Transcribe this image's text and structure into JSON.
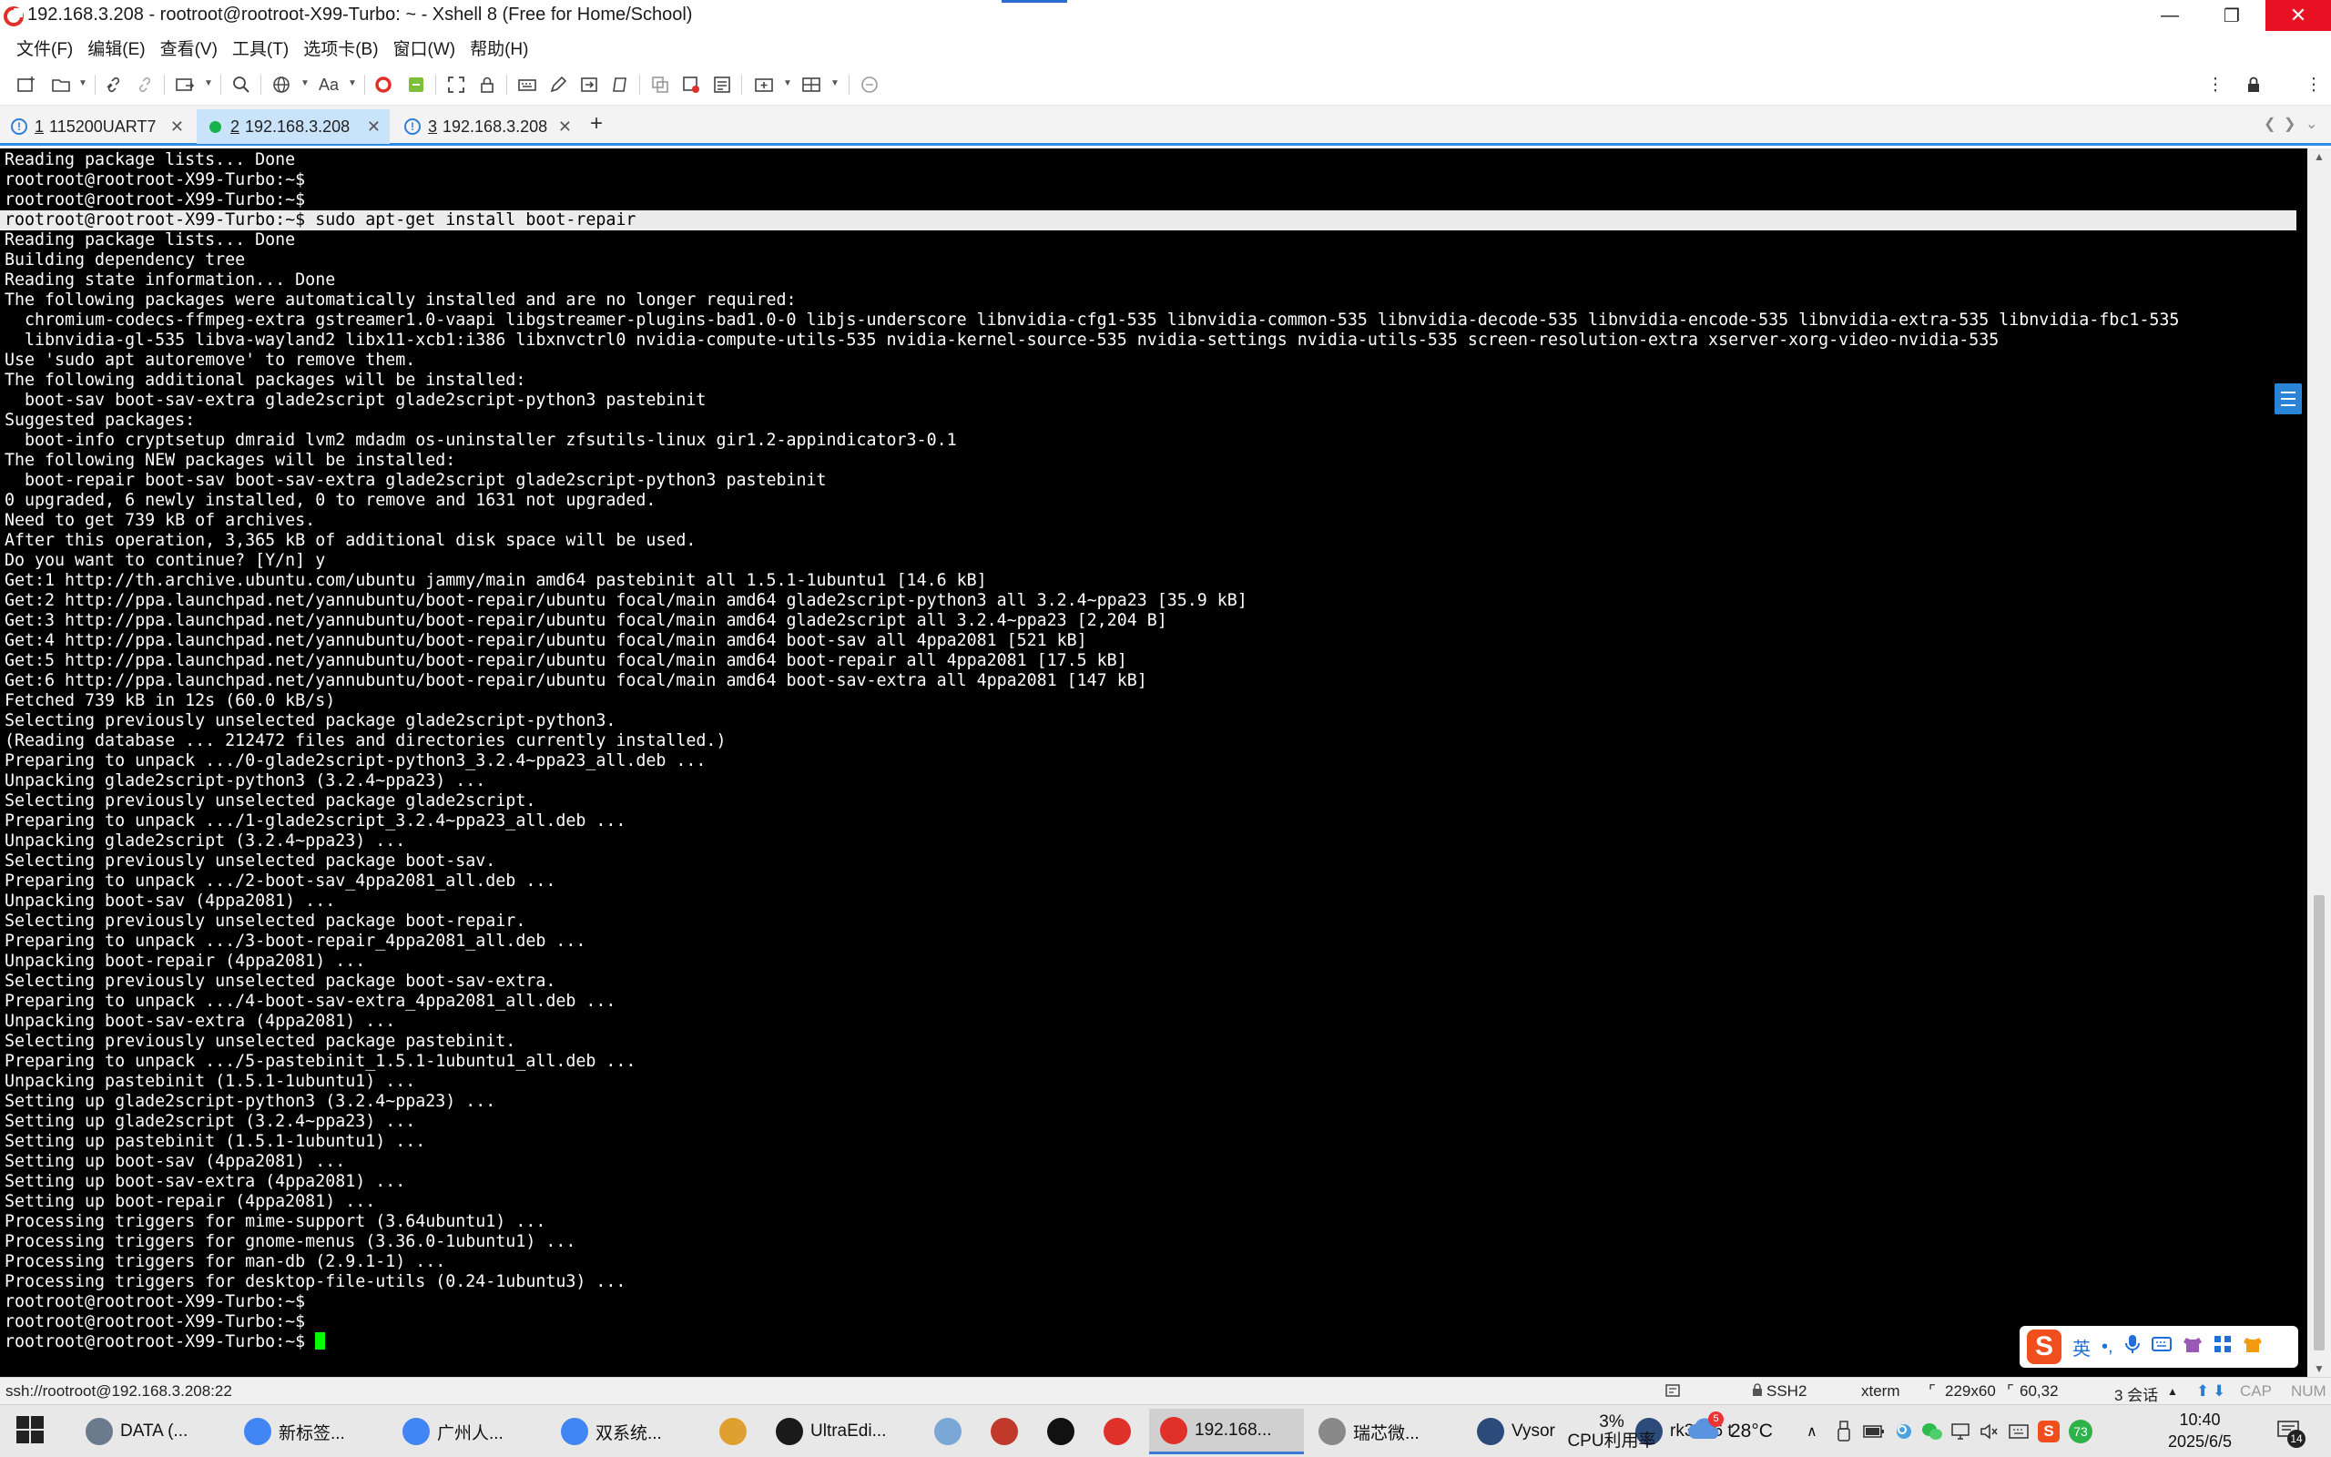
{
  "window": {
    "title": "192.168.3.208 - rootroot@rootroot-X99-Turbo: ~ - Xshell 8 (Free for Home/School)",
    "minimize": "—",
    "maximize": "❐",
    "close": "✕"
  },
  "menu": [
    "文件(F)",
    "编辑(E)",
    "查看(V)",
    "工具(T)",
    "选项卡(B)",
    "窗口(W)",
    "帮助(H)"
  ],
  "toolbar": {
    "font_label": "Aa"
  },
  "tabs": [
    {
      "num": "1",
      "label": "115200UART7",
      "status": "warning",
      "active": false
    },
    {
      "num": "2",
      "label": "192.168.3.208",
      "status": "connected",
      "active": true
    },
    {
      "num": "3",
      "label": "192.168.3.208",
      "status": "warning",
      "active": false
    }
  ],
  "tab_add": "+",
  "terminal": {
    "lines": [
      "Reading package lists... Done",
      "rootroot@rootroot-X99-Turbo:~$",
      "rootroot@rootroot-X99-Turbo:~$",
      "rootroot@rootroot-X99-Turbo:~$ sudo apt-get install boot-repair",
      "Reading package lists... Done",
      "Building dependency tree",
      "Reading state information... Done",
      "The following packages were automatically installed and are no longer required:",
      "  chromium-codecs-ffmpeg-extra gstreamer1.0-vaapi libgstreamer-plugins-bad1.0-0 libjs-underscore libnvidia-cfg1-535 libnvidia-common-535 libnvidia-decode-535 libnvidia-encode-535 libnvidia-extra-535 libnvidia-fbc1-535",
      "  libnvidia-gl-535 libva-wayland2 libx11-xcb1:i386 libxnvctrl0 nvidia-compute-utils-535 nvidia-kernel-source-535 nvidia-settings nvidia-utils-535 screen-resolution-extra xserver-xorg-video-nvidia-535",
      "Use 'sudo apt autoremove' to remove them.",
      "The following additional packages will be installed:",
      "  boot-sav boot-sav-extra glade2script glade2script-python3 pastebinit",
      "Suggested packages:",
      "  boot-info cryptsetup dmraid lvm2 mdadm os-uninstaller zfsutils-linux gir1.2-appindicator3-0.1",
      "The following NEW packages will be installed:",
      "  boot-repair boot-sav boot-sav-extra glade2script glade2script-python3 pastebinit",
      "0 upgraded, 6 newly installed, 0 to remove and 1631 not upgraded.",
      "Need to get 739 kB of archives.",
      "After this operation, 3,365 kB of additional disk space will be used.",
      "Do you want to continue? [Y/n] y",
      "Get:1 http://th.archive.ubuntu.com/ubuntu jammy/main amd64 pastebinit all 1.5.1-1ubuntu1 [14.6 kB]",
      "Get:2 http://ppa.launchpad.net/yannubuntu/boot-repair/ubuntu focal/main amd64 glade2script-python3 all 3.2.4~ppa23 [35.9 kB]",
      "Get:3 http://ppa.launchpad.net/yannubuntu/boot-repair/ubuntu focal/main amd64 glade2script all 3.2.4~ppa23 [2,204 B]",
      "Get:4 http://ppa.launchpad.net/yannubuntu/boot-repair/ubuntu focal/main amd64 boot-sav all 4ppa2081 [521 kB]",
      "Get:5 http://ppa.launchpad.net/yannubuntu/boot-repair/ubuntu focal/main amd64 boot-repair all 4ppa2081 [17.5 kB]",
      "Get:6 http://ppa.launchpad.net/yannubuntu/boot-repair/ubuntu focal/main amd64 boot-sav-extra all 4ppa2081 [147 kB]",
      "Fetched 739 kB in 12s (60.0 kB/s)",
      "Selecting previously unselected package glade2script-python3.",
      "(Reading database ... 212472 files and directories currently installed.)",
      "Preparing to unpack .../0-glade2script-python3_3.2.4~ppa23_all.deb ...",
      "Unpacking glade2script-python3 (3.2.4~ppa23) ...",
      "Selecting previously unselected package glade2script.",
      "Preparing to unpack .../1-glade2script_3.2.4~ppa23_all.deb ...",
      "Unpacking glade2script (3.2.4~ppa23) ...",
      "Selecting previously unselected package boot-sav.",
      "Preparing to unpack .../2-boot-sav_4ppa2081_all.deb ...",
      "Unpacking boot-sav (4ppa2081) ...",
      "Selecting previously unselected package boot-repair.",
      "Preparing to unpack .../3-boot-repair_4ppa2081_all.deb ...",
      "Unpacking boot-repair (4ppa2081) ...",
      "Selecting previously unselected package boot-sav-extra.",
      "Preparing to unpack .../4-boot-sav-extra_4ppa2081_all.deb ...",
      "Unpacking boot-sav-extra (4ppa2081) ...",
      "Selecting previously unselected package pastebinit.",
      "Preparing to unpack .../5-pastebinit_1.5.1-1ubuntu1_all.deb ...",
      "Unpacking pastebinit (1.5.1-1ubuntu1) ...",
      "Setting up glade2script-python3 (3.2.4~ppa23) ...",
      "Setting up glade2script (3.2.4~ppa23) ...",
      "Setting up pastebinit (1.5.1-1ubuntu1) ...",
      "Setting up boot-sav (4ppa2081) ...",
      "Setting up boot-sav-extra (4ppa2081) ...",
      "Setting up boot-repair (4ppa2081) ...",
      "Processing triggers for mime-support (3.64ubuntu1) ...",
      "Processing triggers for gnome-menus (3.36.0-1ubuntu1) ...",
      "Processing triggers for man-db (2.9.1-1) ...",
      "Processing triggers for desktop-file-utils (0.24-1ubuntu3) ...",
      "rootroot@rootroot-X99-Turbo:~$",
      "rootroot@rootroot-X99-Turbo:~$",
      "rootroot@rootroot-X99-Turbo:~$ "
    ],
    "highlighted_line": 3,
    "cursor_line": 59
  },
  "ime": {
    "logo": "S",
    "lang": "英",
    "punct": "•,"
  },
  "statusbar": {
    "connection": "ssh://rootroot@192.168.3.208:22",
    "protocol": "SSH2",
    "term": "xterm",
    "size": "229x60",
    "cursor_pos": "60,32",
    "sessions": "3 会话",
    "cap": "CAP",
    "num": "NUM"
  },
  "taskbar": {
    "apps": [
      {
        "label": "DATA (...",
        "icon": "drive-icon",
        "color": "#6b7b8c"
      },
      {
        "label": "新标签...",
        "icon": "chrome-icon",
        "color": "#4285f4"
      },
      {
        "label": "广州人...",
        "icon": "chrome-icon",
        "color": "#4285f4"
      },
      {
        "label": "双系统...",
        "icon": "chrome-icon",
        "color": "#4285f4"
      },
      {
        "label": "",
        "icon": "paint-icon",
        "color": "#e0a030"
      },
      {
        "label": "UltraEdi...",
        "icon": "ultraedit-icon",
        "color": "#1a1a1a"
      },
      {
        "label": "",
        "icon": "notepad-icon",
        "color": "#7aa7d6"
      },
      {
        "label": "",
        "icon": "record-icon",
        "color": "#c0392b"
      },
      {
        "label": "",
        "icon": "cmd-icon",
        "color": "#111111"
      },
      {
        "label": "",
        "icon": "wps-icon",
        "color": "#e0302a"
      },
      {
        "label": "192.168...",
        "icon": "xshell-icon",
        "color": "#e0302a",
        "active": true
      },
      {
        "label": "瑞芯微...",
        "icon": "tool-icon",
        "color": "#888888"
      },
      {
        "label": "Vysor",
        "icon": "vysor-icon",
        "color": "#2c4a7a"
      },
      {
        "label": "rk3566 t",
        "icon": "vysor-icon",
        "color": "#2c4a7a"
      }
    ],
    "cpu_percent": "3%",
    "cpu_label": "CPU利用率",
    "weather_badge": "5",
    "temperature": "28°C",
    "time": "10:40",
    "date": "2025/6/5",
    "notification_count": "14"
  }
}
